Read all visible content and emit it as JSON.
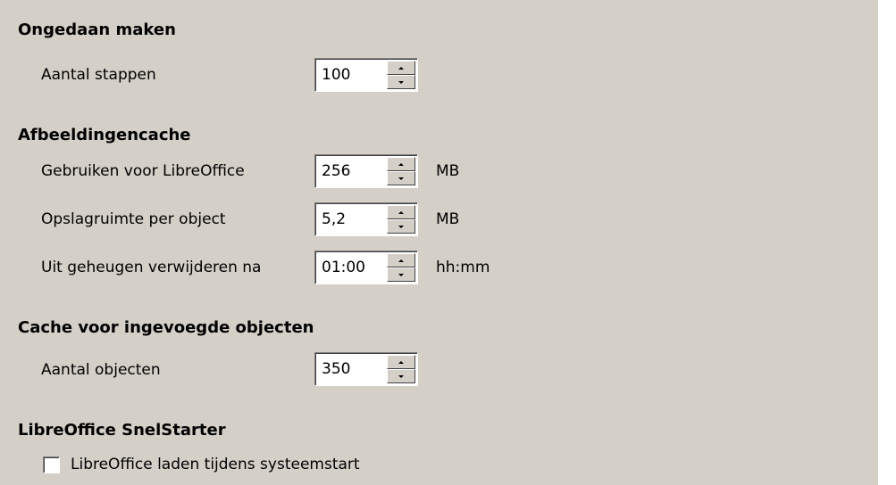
{
  "sections": {
    "undo": {
      "heading": "Ongedaan maken",
      "steps_label": "Aantal stappen",
      "steps_value": "100"
    },
    "image_cache": {
      "heading": "Afbeeldingencache",
      "use_label": "Gebruiken voor LibreOffice",
      "use_value": "256",
      "use_unit": "MB",
      "per_object_label": "Opslagruimte per object",
      "per_object_value": "5,2",
      "per_object_unit": "MB",
      "remove_label": "Uit geheugen verwijderen na",
      "remove_value": "01:00",
      "remove_unit": "hh:mm"
    },
    "object_cache": {
      "heading": "Cache voor ingevoegde objecten",
      "count_label": "Aantal objecten",
      "count_value": "350"
    },
    "quickstarter": {
      "heading": "LibreOffice SnelStarter",
      "load_label": "LibreOffice laden tijdens systeemstart",
      "load_checked": false
    }
  },
  "icons": {
    "spin_up": "chevron-up-icon",
    "spin_down": "chevron-down-icon"
  }
}
